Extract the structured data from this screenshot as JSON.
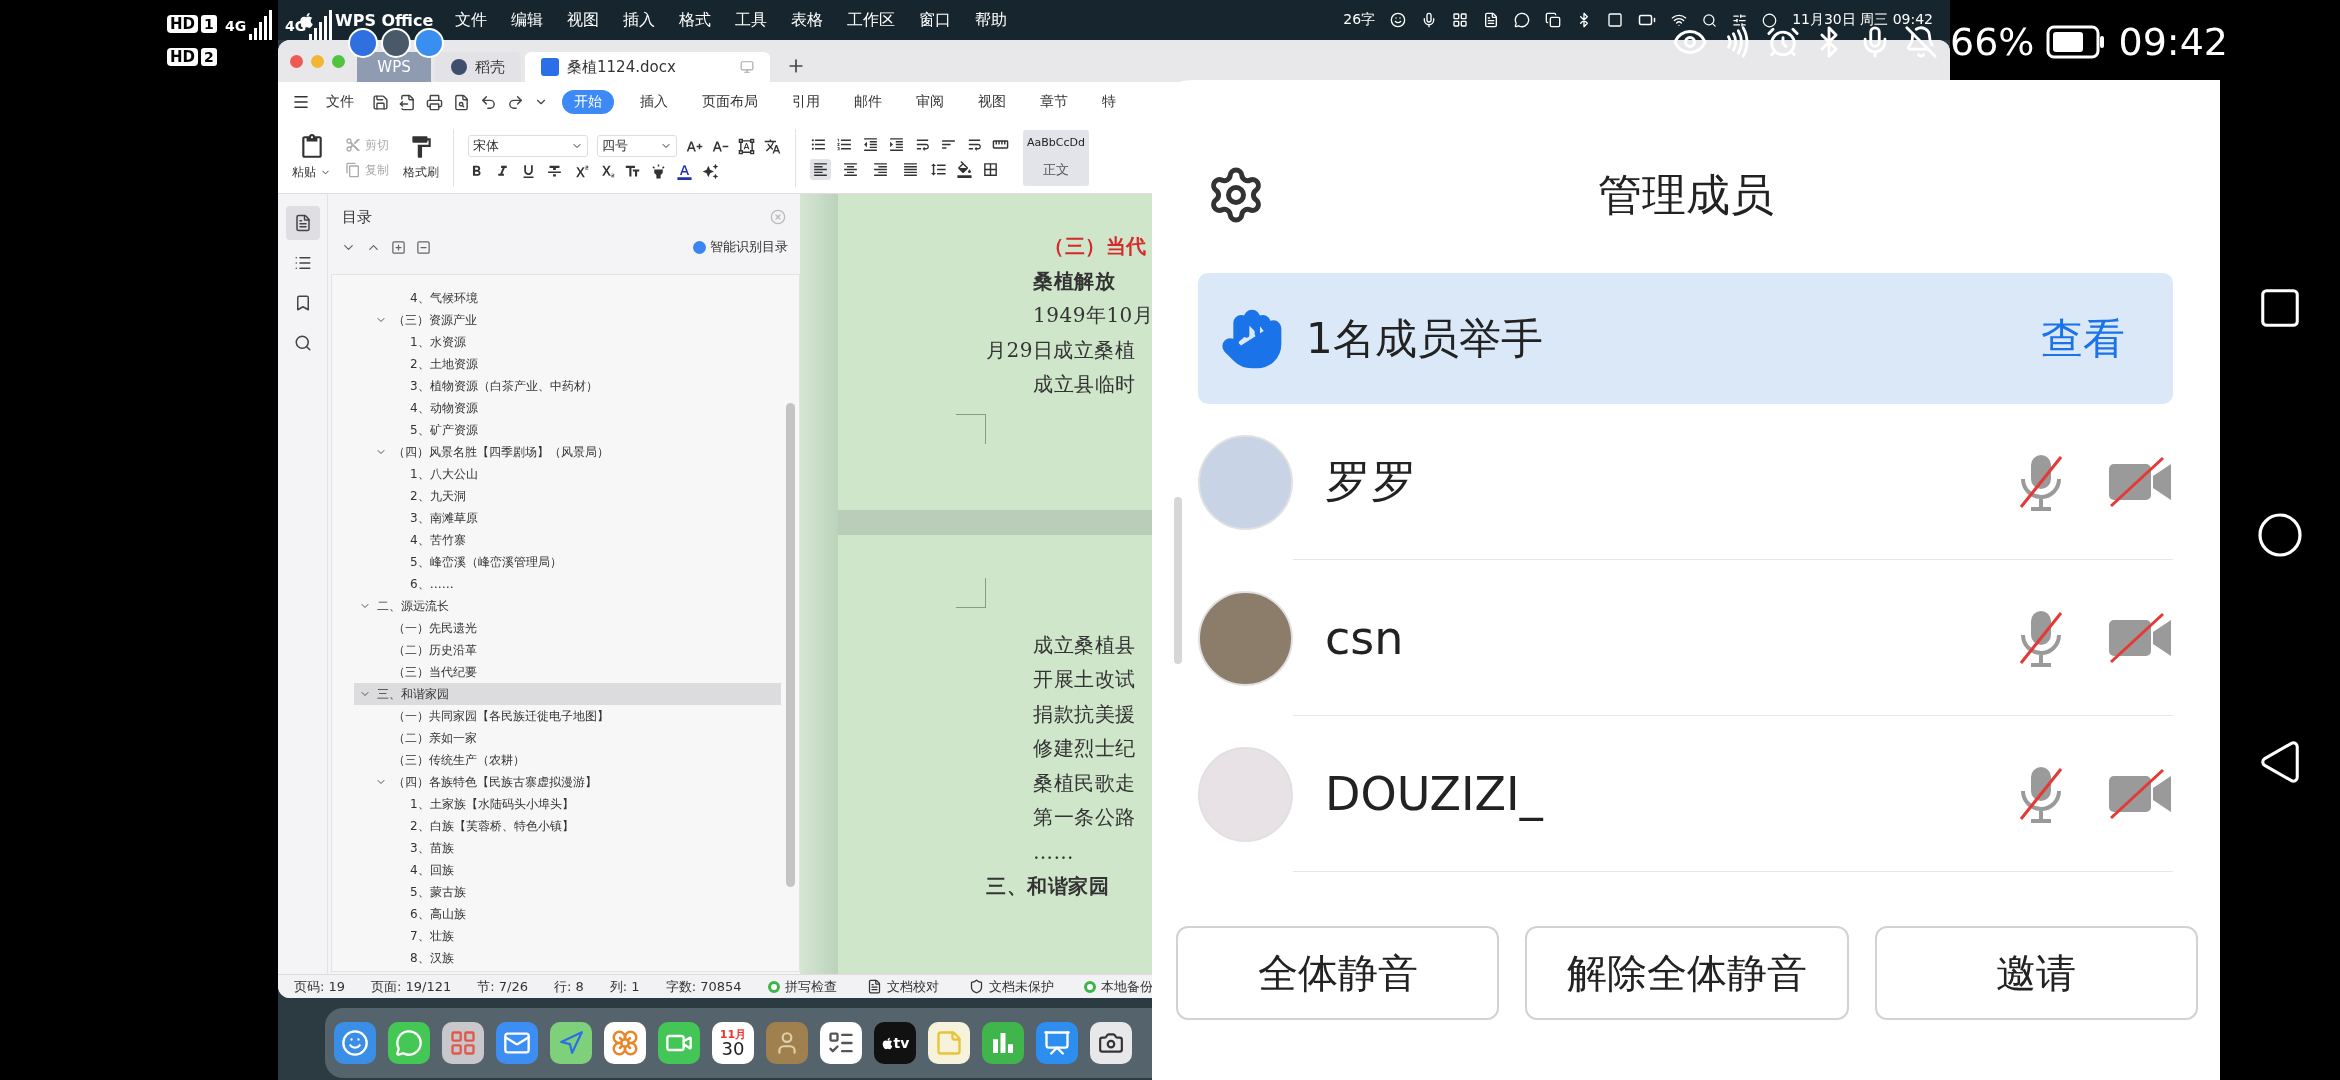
{
  "phone_status": {
    "sims": [
      {
        "hd": "HD",
        "slot": "1",
        "network": "4G"
      },
      {
        "hd": "HD",
        "slot": "2",
        "network": "4G"
      }
    ],
    "battery": "66%",
    "time": "09:42"
  },
  "mac_menubar": {
    "app": "WPS Office",
    "menus": [
      "文件",
      "编辑",
      "视图",
      "插入",
      "格式",
      "工具",
      "表格",
      "工作区",
      "窗口",
      "帮助"
    ],
    "word_count": "26字",
    "datetime": "11月30日 周三 09:42"
  },
  "window_tabs": [
    {
      "label": "WPS",
      "kind": "brand",
      "selected": false
    },
    {
      "label": "稻壳",
      "kind": "app",
      "selected": false
    },
    {
      "label": "桑植1124.docx",
      "kind": "document",
      "selected": true
    }
  ],
  "menu_row": {
    "file": "文件",
    "tabs": [
      {
        "label": "开始",
        "selected": true
      },
      {
        "label": "插入",
        "selected": false
      },
      {
        "label": "页面布局",
        "selected": false
      },
      {
        "label": "引用",
        "selected": false
      },
      {
        "label": "邮件",
        "selected": false
      },
      {
        "label": "审阅",
        "selected": false
      },
      {
        "label": "视图",
        "selected": false
      },
      {
        "label": "章节",
        "selected": false
      },
      {
        "label": "特",
        "selected": false
      }
    ]
  },
  "ribbon": {
    "paste": "粘贴",
    "cut": {
      "label": "剪切",
      "disabled": true
    },
    "copy": {
      "label": "复制",
      "disabled": true
    },
    "format_painter": "格式刷",
    "font": "宋体",
    "size": "四号",
    "align_buttons": [
      {
        "selected": true
      },
      {
        "selected": false
      },
      {
        "selected": false
      },
      {
        "selected": false
      }
    ],
    "style_preview": "AaBbCcDd",
    "style_name": "正文"
  },
  "side_tools": [
    {
      "selected": true
    },
    {
      "selected": false
    },
    {
      "selected": false
    },
    {
      "selected": false
    }
  ],
  "toc": {
    "title": "目录",
    "smart_button": "智能识别目录",
    "items": [
      {
        "children": [
          {
            "children": [
              {
                "label": "4、气候环境",
                "selected": false
              }
            ]
          },
          {
            "label": "（三）资源产业",
            "expanded": true,
            "selected": false,
            "children": [
              {
                "label": "1、水资源",
                "selected": false
              },
              {
                "label": "2、土地资源",
                "selected": false
              },
              {
                "label": "3、植物资源（白茶产业、中药材）",
                "selected": false
              },
              {
                "label": "4、动物资源",
                "selected": false
              },
              {
                "label": "5、矿产资源",
                "selected": false
              }
            ]
          },
          {
            "label": "（四）风景名胜【四季剧场】（风景局）",
            "expanded": true,
            "selected": false,
            "children": [
              {
                "label": "1、八大公山",
                "selected": false
              },
              {
                "label": "2、九天洞",
                "selected": false
              },
              {
                "label": "3、南滩草原",
                "selected": false
              },
              {
                "label": "4、苦竹寨",
                "selected": false
              },
              {
                "label": "5、峰峦溪（峰峦溪管理局）",
                "selected": false
              },
              {
                "label": "6、……",
                "selected": false
              }
            ]
          }
        ]
      },
      {
        "label": "二、源远流长",
        "expanded": true,
        "selected": false,
        "children": [
          {
            "label": "（一）先民遗光",
            "selected": false
          },
          {
            "label": "（二）历史沿革",
            "selected": false
          },
          {
            "label": "（三）当代纪要",
            "selected": false
          }
        ]
      },
      {
        "label": "三、和谐家园",
        "expanded": true,
        "selected": true,
        "children": [
          {
            "label": "（一）共同家园【各民族迁徙电子地图】",
            "selected": false
          },
          {
            "label": "（二）亲如一家",
            "selected": false
          },
          {
            "label": "（三）传统生产（农耕）",
            "selected": false
          },
          {
            "label": "（四）各族特色【民族古寨虚拟漫游】",
            "expanded": true,
            "selected": false,
            "children": [
              {
                "label": "1、土家族【水陆码头小埠头】",
                "selected": false
              },
              {
                "label": "2、白族【芙蓉桥、特色小镇】",
                "selected": false
              },
              {
                "label": "3、苗族",
                "selected": false
              },
              {
                "label": "4、回族",
                "selected": false
              },
              {
                "label": "5、蒙古族",
                "selected": false
              },
              {
                "label": "6、高山族",
                "selected": false
              },
              {
                "label": "7、壮族",
                "selected": false
              },
              {
                "label": "8、汉族",
                "selected": false
              }
            ]
          }
        ]
      }
    ]
  },
  "document": {
    "pages": [
      {
        "lines": [
          {
            "text": "（三）当代",
            "kind": "section"
          },
          {
            "text": "桑植解放",
            "kind": "title"
          },
          {
            "text": "1949年10月",
            "kind": "indent"
          },
          {
            "text": "月29日成立桑植",
            "kind": "wrap"
          },
          {
            "text": "成立县临时",
            "kind": "indent"
          }
        ]
      },
      {
        "lines": [
          {
            "text": "成立桑植县",
            "kind": "indent"
          },
          {
            "text": "开展土改试",
            "kind": "indent"
          },
          {
            "text": "捐款抗美援",
            "kind": "indent"
          },
          {
            "text": "修建烈士纪",
            "kind": "indent"
          },
          {
            "text": "桑植民歌走",
            "kind": "indent"
          },
          {
            "text": "第一条公路",
            "kind": "indent"
          },
          {
            "text": "……",
            "kind": "indent"
          },
          {
            "text": "三、和谐家园",
            "kind": "chapter"
          }
        ]
      }
    ]
  },
  "status_bar": {
    "items": [
      "页码: 19",
      "页面: 19/121",
      "节: 7/26",
      "行: 8",
      "列: 1",
      "字数: 70854"
    ],
    "tools": [
      {
        "label": "拼写检查",
        "kind": "dot"
      },
      {
        "label": "文档校对",
        "kind": "doc"
      },
      {
        "label": "文档未保护",
        "kind": "shield"
      },
      {
        "label": "本地备份",
        "kind": "dot"
      }
    ]
  },
  "dock": {
    "calendar_month": "11月",
    "calendar_day": "30",
    "tv_label": "tv"
  },
  "meeting_panel": {
    "title": "管理成员",
    "raise_hand": {
      "text": "1名成员举手",
      "action": "查看"
    },
    "members": [
      {
        "name": "罗罗",
        "mic_muted": true,
        "camera_off": true
      },
      {
        "name": "csn",
        "mic_muted": true,
        "camera_off": true
      },
      {
        "name": "DOUZIZI_",
        "mic_muted": true,
        "camera_off": true
      }
    ],
    "buttons": [
      "全体静音",
      "解除全体静音",
      "邀请"
    ]
  }
}
